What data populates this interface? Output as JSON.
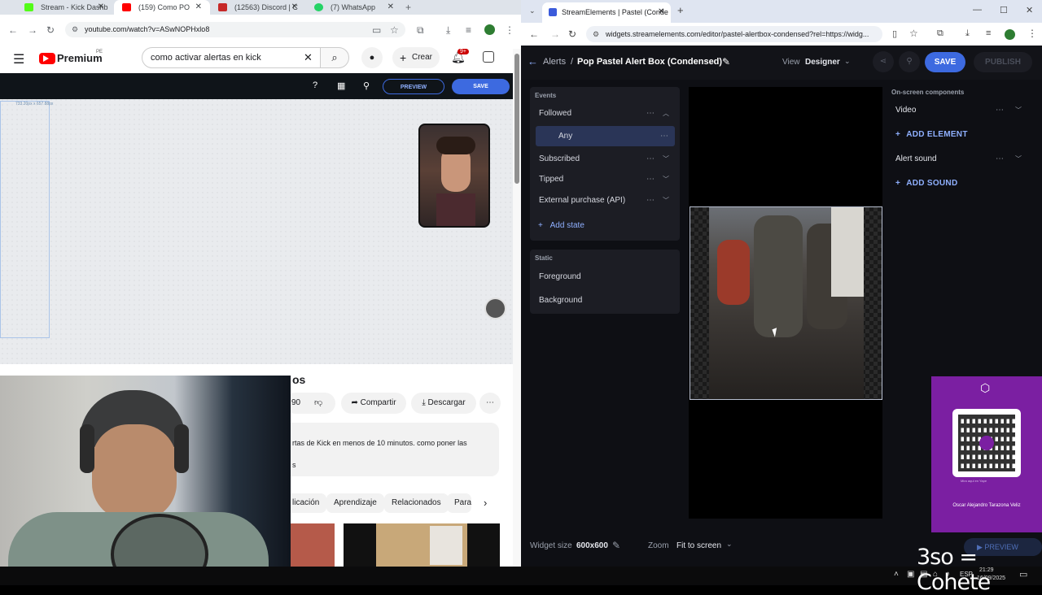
{
  "left_browser": {
    "tabs": [
      {
        "label": "Stream - Kick Dashb",
        "icon_color": "#53fc18"
      },
      {
        "label": "(159) Como PO",
        "icon_color": "#ff0000"
      },
      {
        "label": "(12563) Discord | C",
        "icon_color": "#c62828"
      },
      {
        "label": "(7) WhatsApp",
        "icon_color": "#25d366"
      }
    ],
    "url": "youtube.com/watch?v=ASwNOPHxlo8",
    "youtube": {
      "logo_text": "Premium",
      "logo_superscript": "PE",
      "search_value": "como activar alertas en kick",
      "create_label": "Crear",
      "notif_badge": "9+"
    },
    "video_editor": {
      "preview_label": "PREVIEW",
      "save_label": "SAVE",
      "size_label": "733.20px x 657.88px"
    },
    "title_partial": "os",
    "actions": {
      "likes_partial": "90",
      "share": "Compartir",
      "download": "Descargar"
    },
    "description": {
      "line1": "rtas de Kick en menos de 10 minutos. como poner las",
      "line2": "s"
    },
    "chips": [
      "licación",
      "Aprendizaje",
      "Relacionados",
      "Para"
    ]
  },
  "right_browser": {
    "tab_label": "StreamElements | Pastel (Conde",
    "url": "widgets.streamelements.com/editor/pastel-alertbox-condensed?rel=https://widg...",
    "header": {
      "breadcrumb_root": "Alerts",
      "breadcrumb_sep": "/",
      "title": "Pop Pastel Alert Box (Condensed)",
      "view_label": "View",
      "view_value": "Designer",
      "save": "SAVE",
      "publish": "PUBLISH"
    },
    "events_section": "Events",
    "events": [
      {
        "label": "Followed",
        "expanded": true
      },
      {
        "label": "Subscribed",
        "expanded": false
      },
      {
        "label": "Tipped",
        "expanded": false
      },
      {
        "label": "External purchase (API)",
        "expanded": false
      }
    ],
    "followed_state": "Any",
    "add_state": "Add state",
    "static_section": "Static",
    "static_items": [
      "Foreground",
      "Background"
    ],
    "onscreen_section": "On-screen components",
    "components": [
      "Video",
      "Alert sound"
    ],
    "add_element": "ADD ELEMENT",
    "add_sound": "ADD SOUND",
    "widget_size_label": "Widget size",
    "widget_size_value": "600x600",
    "zoom_label": "Zoom",
    "zoom_value": "Fit to screen",
    "preview_partial": "PREVIEW"
  },
  "overlay": {
    "qr_caption_small": "Mira aqui en Yape",
    "qr_name": "Oscar Alejandro Tarazona Veliz",
    "caption": "3so = Cohete"
  },
  "taskbar": {
    "lang": "ESP",
    "time": "21:29",
    "date": "16/09/2025"
  }
}
